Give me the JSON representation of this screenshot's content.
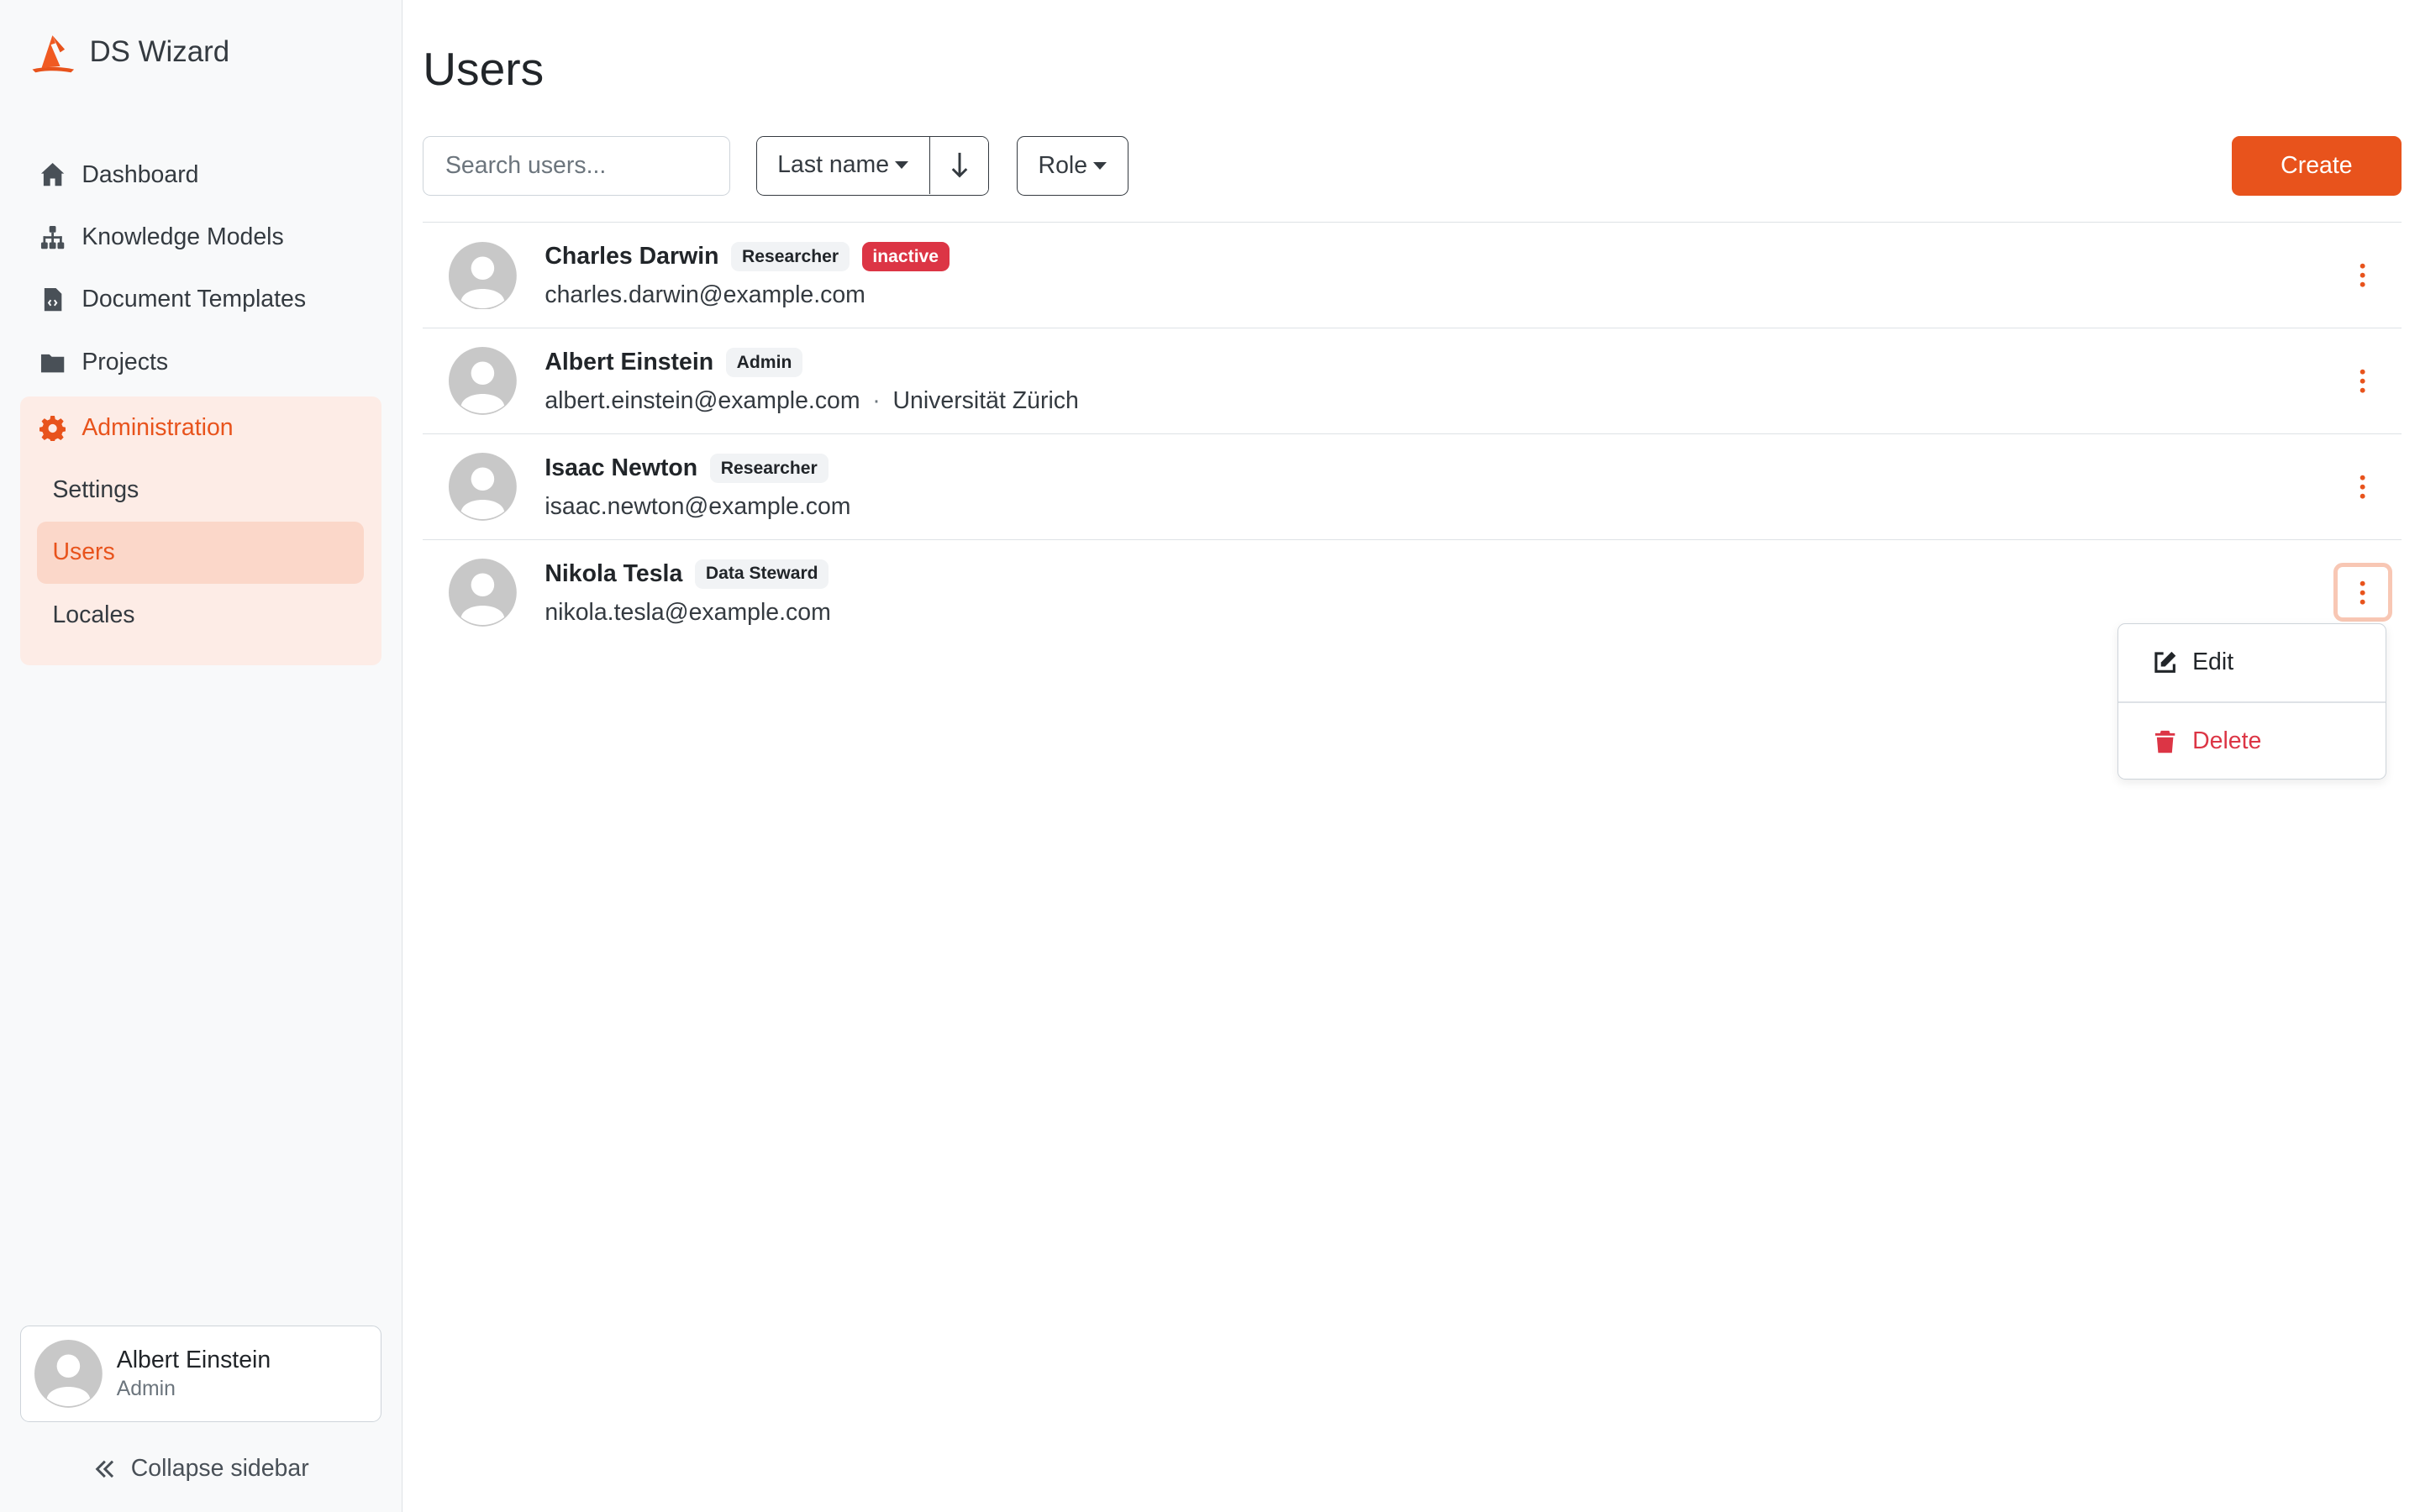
{
  "app": {
    "name": "DS Wizard",
    "accent": "#e8531c"
  },
  "nav": {
    "items": [
      {
        "label": "Dashboard",
        "icon": "home-icon"
      },
      {
        "label": "Knowledge Models",
        "icon": "sitemap-icon"
      },
      {
        "label": "Document Templates",
        "icon": "file-code-icon"
      },
      {
        "label": "Projects",
        "icon": "folder-icon"
      }
    ],
    "admin": {
      "label": "Administration",
      "icon": "gear-icon",
      "sub": [
        {
          "label": "Settings",
          "active": false
        },
        {
          "label": "Users",
          "active": true
        },
        {
          "label": "Locales",
          "active": false
        }
      ]
    }
  },
  "profile": {
    "name": "Albert Einstein",
    "role": "Admin"
  },
  "sidebar": {
    "collapse_label": "Collapse sidebar"
  },
  "page": {
    "title": "Users"
  },
  "toolbar": {
    "search_placeholder": "Search users...",
    "sort_label": "Last name",
    "role_label": "Role",
    "create_label": "Create"
  },
  "users": [
    {
      "name": "Charles Darwin",
      "role": "Researcher",
      "status": "inactive",
      "email": "charles.darwin@example.com",
      "affiliation": ""
    },
    {
      "name": "Albert Einstein",
      "role": "Admin",
      "status": "",
      "email": "albert.einstein@example.com",
      "affiliation": "Universität Zürich"
    },
    {
      "name": "Isaac Newton",
      "role": "Researcher",
      "status": "",
      "email": "isaac.newton@example.com",
      "affiliation": ""
    },
    {
      "name": "Nikola Tesla",
      "role": "Data Steward",
      "status": "",
      "email": "nikola.tesla@example.com",
      "affiliation": ""
    }
  ],
  "dropdown": {
    "edit_label": "Edit",
    "delete_label": "Delete"
  },
  "separator": "·"
}
